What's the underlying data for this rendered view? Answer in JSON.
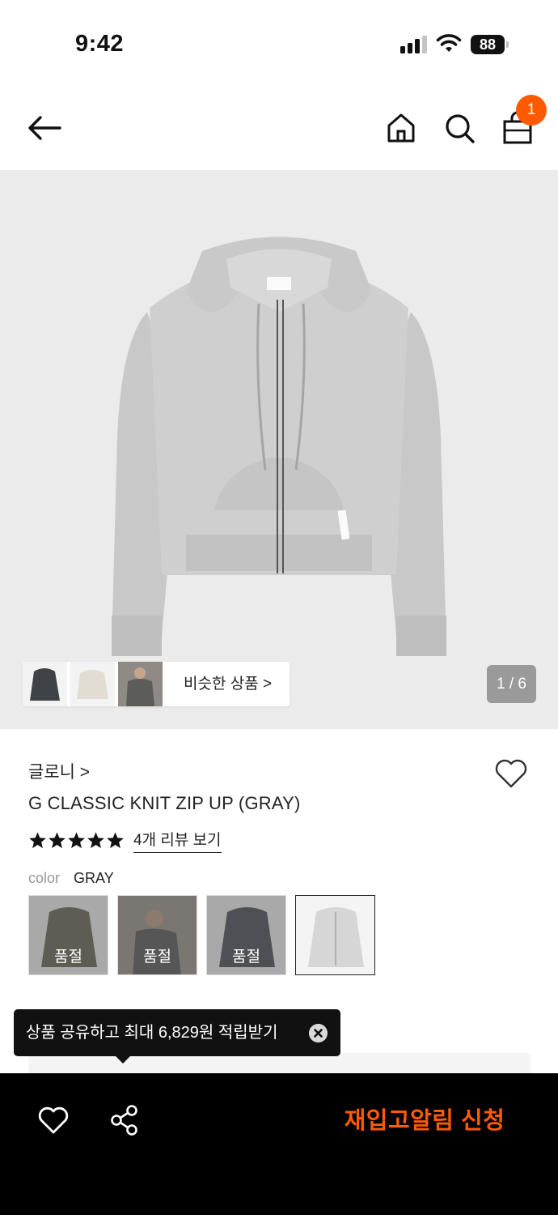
{
  "status_bar": {
    "time": "9:42",
    "battery": "88"
  },
  "header": {
    "cart_count": "1",
    "icons": [
      "arrow-left-icon",
      "home-icon",
      "search-icon",
      "shopping-bag-icon"
    ]
  },
  "gallery": {
    "similar_label": "비슷한 상품 >",
    "page_indicator": "1 / 6"
  },
  "product": {
    "brand": "글로니 >",
    "name": "G CLASSIC KNIT ZIP UP (GRAY)",
    "rating_stars": 5,
    "review_link": "4개 리뷰 보기",
    "color_label": "color",
    "color_value": "GRAY",
    "swatches": [
      {
        "soldout_label": "품절",
        "tone": "#4b4a36"
      },
      {
        "soldout_label": "품절",
        "tone": "#6b6560"
      },
      {
        "soldout_label": "품절",
        "tone": "#2a2d38"
      },
      {
        "soldout_label": "",
        "tone": "#d8d8d8"
      }
    ]
  },
  "tooltip": {
    "text": "상품 공유하고 최대 6,829원 적립받기"
  },
  "bottom_bar": {
    "restock_label": "재입고알림 신청"
  },
  "colors": {
    "accent": "#ff5a00",
    "bottom_bar": "#000000",
    "gallery_bg": "#ebebeb"
  }
}
